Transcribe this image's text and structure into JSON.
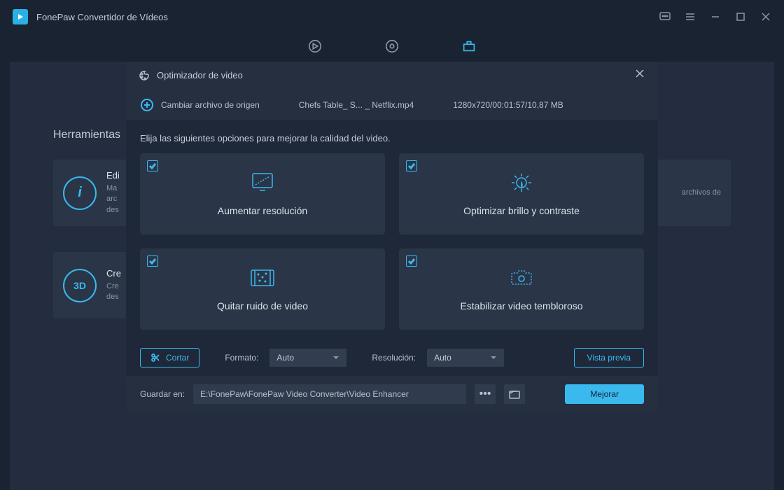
{
  "app": {
    "title": "FonePaw Convertidor de Vídeos"
  },
  "background": {
    "heading": "Herramientas",
    "card1": {
      "title": "Edi",
      "desc1": "Ma",
      "desc2": "arc",
      "desc3": "des"
    },
    "card2": {
      "desc": "archivos de"
    },
    "card3": {
      "title": "Cre",
      "desc1": "Cre",
      "desc2": "des",
      "icon_label": "3D"
    },
    "info_icon": "i"
  },
  "modal": {
    "title": "Optimizador de video",
    "change_source": "Cambiar archivo de origen",
    "file": "Chefs Table_ S... _ Netflix.mp4",
    "meta": "1280x720/00:01:57/10,87 MB",
    "instruction": "Elija las siguientes opciones para mejorar la calidad del video.",
    "options": {
      "upscale": "Aumentar resolución",
      "brightness": "Optimizar brillo y contraste",
      "denoise": "Quitar ruido de video",
      "stabilize": "Estabilizar video tembloroso"
    },
    "cut": "Cortar",
    "format_label": "Formato:",
    "format_value": "Auto",
    "resolution_label": "Resolución:",
    "resolution_value": "Auto",
    "preview": "Vista previa",
    "save_label": "Guardar en:",
    "save_path": "E:\\FonePaw\\FonePaw Video Converter\\Video Enhancer",
    "enhance": "Mejorar"
  }
}
